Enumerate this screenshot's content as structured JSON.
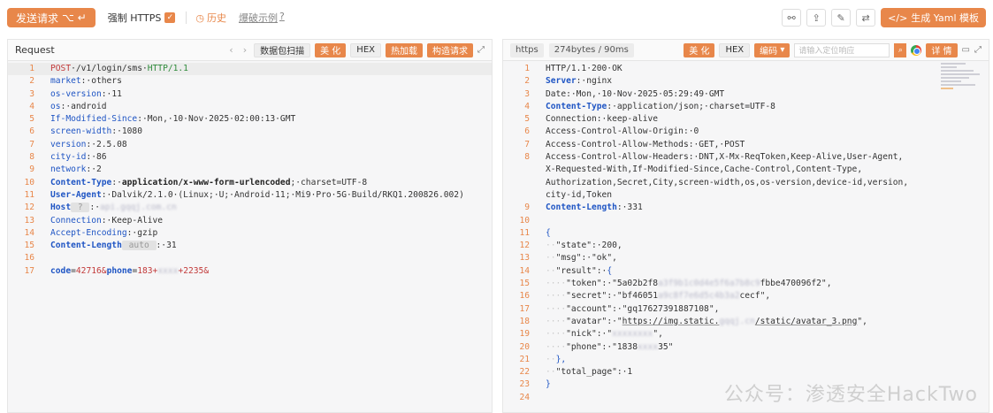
{
  "toolbar": {
    "send_label": "发送请求",
    "send_shortcut": "⌥ ↵",
    "force_https_label": "强制 HTTPS",
    "force_https_checked": true,
    "history_label": "历史",
    "example_label": "爆破示例",
    "yaml_label": "生成 Yaml 模板"
  },
  "request": {
    "title": "Request",
    "buttons": {
      "scan": "数据包扫描",
      "beautify": "美 化",
      "hex": "HEX",
      "hotload": "热加载",
      "build": "构造请求"
    },
    "lines": [
      {
        "n": "1",
        "hl": true,
        "parts": [
          [
            "k-method",
            "POST"
          ],
          [
            "txt",
            "·/v1/login/sms·"
          ],
          [
            "k-proto",
            "HTTP/1.1"
          ]
        ]
      },
      {
        "n": "2",
        "parts": [
          [
            "k-key",
            "market"
          ],
          [
            "txt",
            ":·others"
          ]
        ]
      },
      {
        "n": "3",
        "parts": [
          [
            "k-key",
            "os-version"
          ],
          [
            "txt",
            ":·11"
          ]
        ]
      },
      {
        "n": "4",
        "parts": [
          [
            "k-key",
            "os"
          ],
          [
            "txt",
            ":·android"
          ]
        ]
      },
      {
        "n": "5",
        "parts": [
          [
            "k-key",
            "If-Modified-Since"
          ],
          [
            "txt",
            ":·Mon,·10·Nov·2025·02:00:13·GMT"
          ]
        ]
      },
      {
        "n": "6",
        "parts": [
          [
            "k-key",
            "screen-width"
          ],
          [
            "txt",
            ":·1080"
          ]
        ]
      },
      {
        "n": "7",
        "parts": [
          [
            "k-key",
            "version"
          ],
          [
            "txt",
            ":·2.5.08"
          ]
        ]
      },
      {
        "n": "8",
        "parts": [
          [
            "k-key",
            "city-id"
          ],
          [
            "txt",
            ":·86"
          ]
        ]
      },
      {
        "n": "9",
        "parts": [
          [
            "k-key",
            "network"
          ],
          [
            "txt",
            ":·2"
          ]
        ]
      },
      {
        "n": "10",
        "parts": [
          [
            "k-keyb",
            "Content-Type"
          ],
          [
            "txt",
            ":·"
          ],
          [
            "k-valb",
            "application/x-www-form-urlencoded"
          ],
          [
            "txt",
            ";·charset=UTF-8"
          ]
        ]
      },
      {
        "n": "11",
        "parts": [
          [
            "k-keyb",
            "User-Agent"
          ],
          [
            "txt",
            ":·Dalvik/2.1.0·(Linux;·U;·Android·11;·Mi9·Pro·5G·Build/RKQ1.200826.002)"
          ]
        ]
      },
      {
        "n": "12",
        "parts": [
          [
            "k-keyb",
            "Host"
          ],
          [
            "pill",
            " ? "
          ],
          [
            "txt",
            ":·"
          ],
          [
            "blur",
            "api.gqqj.com.cn"
          ]
        ]
      },
      {
        "n": "13",
        "parts": [
          [
            "k-key",
            "Connection"
          ],
          [
            "txt",
            ":·Keep-Alive"
          ]
        ]
      },
      {
        "n": "14",
        "parts": [
          [
            "k-key",
            "Accept-Encoding"
          ],
          [
            "txt",
            ":·gzip"
          ]
        ]
      },
      {
        "n": "15",
        "parts": [
          [
            "k-keyb",
            "Content-Length"
          ],
          [
            "pill",
            " auto "
          ],
          [
            "txt",
            ":·31"
          ]
        ]
      },
      {
        "n": "16",
        "parts": []
      },
      {
        "n": "17",
        "parts": [
          [
            "k-keyb",
            "code"
          ],
          [
            "txt",
            "="
          ],
          [
            "k-bval",
            "42716"
          ],
          [
            "k-amp",
            "&"
          ],
          [
            "k-keyb",
            "phone"
          ],
          [
            "txt",
            "="
          ],
          [
            "k-bval",
            "183+"
          ],
          [
            "blur",
            "xxxx"
          ],
          [
            "k-bval",
            "+2235"
          ],
          [
            "k-amp",
            "&"
          ]
        ]
      }
    ]
  },
  "response": {
    "tag_https": "https",
    "tag_meta": "274bytes / 90ms",
    "buttons": {
      "beautify": "美 化",
      "hex": "HEX",
      "encode": "编码",
      "detail": "详 情"
    },
    "search_placeholder": "请输入定位响应",
    "lines": [
      {
        "n": "1",
        "parts": [
          [
            "txt",
            "HTTP/1.1·200·OK"
          ]
        ]
      },
      {
        "n": "2",
        "parts": [
          [
            "k-keyb",
            "Server"
          ],
          [
            "txt",
            ":·nginx"
          ]
        ]
      },
      {
        "n": "3",
        "parts": [
          [
            "txt",
            "Date:·Mon,·10·Nov·2025·05:29:49·GMT"
          ]
        ]
      },
      {
        "n": "4",
        "parts": [
          [
            "k-keyb",
            "Content-Type"
          ],
          [
            "txt",
            ":·application/json;·charset=UTF-8"
          ]
        ]
      },
      {
        "n": "5",
        "parts": [
          [
            "txt",
            "Connection:·keep-alive"
          ]
        ]
      },
      {
        "n": "6",
        "parts": [
          [
            "txt",
            "Access-Control-Allow-Origin:·0"
          ]
        ]
      },
      {
        "n": "7",
        "parts": [
          [
            "txt",
            "Access-Control-Allow-Methods:·GET,·POST"
          ]
        ]
      },
      {
        "n": "8",
        "parts": [
          [
            "txt",
            "Access-Control-Allow-Headers:·DNT,X-Mx-ReqToken,Keep-Alive,User-Agent,"
          ]
        ]
      },
      {
        "n": "",
        "parts": [
          [
            "txt",
            "X-Requested-With,If-Modified-Since,Cache-Control,Content-Type,"
          ]
        ]
      },
      {
        "n": "",
        "parts": [
          [
            "txt",
            "Authorization,Secret,City,screen-width,os,os-version,device-id,version,"
          ]
        ]
      },
      {
        "n": "",
        "parts": [
          [
            "txt",
            "city-id,Token"
          ]
        ]
      },
      {
        "n": "9",
        "parts": [
          [
            "k-keyb",
            "Content-Length"
          ],
          [
            "txt",
            ":·331"
          ]
        ]
      },
      {
        "n": "10",
        "parts": []
      },
      {
        "n": "11",
        "parts": [
          [
            "k-key",
            "{"
          ]
        ]
      },
      {
        "n": "12",
        "parts": [
          [
            "guide",
            "··"
          ],
          [
            "txt",
            "\"state\":·200,"
          ]
        ]
      },
      {
        "n": "13",
        "parts": [
          [
            "guide",
            "··"
          ],
          [
            "txt",
            "\"msg\":·\"ok\","
          ]
        ]
      },
      {
        "n": "14",
        "parts": [
          [
            "guide",
            "··"
          ],
          [
            "txt",
            "\"result\":·"
          ],
          [
            "k-key",
            "{"
          ]
        ]
      },
      {
        "n": "15",
        "parts": [
          [
            "guide",
            "····"
          ],
          [
            "txt",
            "\"token\":·\"5a02b2f8"
          ],
          [
            "blur",
            "a3f9b1c0d4e5f6a7b8c9"
          ],
          [
            "txt",
            "fbbe470096f2\","
          ]
        ]
      },
      {
        "n": "16",
        "parts": [
          [
            "guide",
            "····"
          ],
          [
            "txt",
            "\"secret\":·\"bf46051"
          ],
          [
            "blur",
            "a9c8f7e6d5c4b3a2"
          ],
          [
            "txt",
            "cecf\","
          ]
        ]
      },
      {
        "n": "17",
        "parts": [
          [
            "guide",
            "····"
          ],
          [
            "txt",
            "\"account\":·\"gq17627391887108\","
          ]
        ]
      },
      {
        "n": "18",
        "parts": [
          [
            "guide",
            "····"
          ],
          [
            "txt",
            "\"avatar\":·\""
          ],
          [
            "link",
            "https://img.static."
          ],
          [
            "blur",
            "gqqj.cn"
          ],
          [
            "link",
            "/static/avatar_3.png"
          ],
          [
            "txt",
            "\","
          ]
        ]
      },
      {
        "n": "19",
        "parts": [
          [
            "guide",
            "····"
          ],
          [
            "txt",
            "\"nick\":·\""
          ],
          [
            "blur",
            "xxxxxxxx"
          ],
          [
            "txt",
            "\","
          ]
        ]
      },
      {
        "n": "20",
        "parts": [
          [
            "guide",
            "····"
          ],
          [
            "txt",
            "\"phone\":·\"1838"
          ],
          [
            "blur",
            "xxxx"
          ],
          [
            "txt",
            "35\""
          ]
        ]
      },
      {
        "n": "21",
        "parts": [
          [
            "guide",
            "··"
          ],
          [
            "k-key",
            "},"
          ]
        ]
      },
      {
        "n": "22",
        "parts": [
          [
            "guide",
            "··"
          ],
          [
            "txt",
            "\"total_page\":·1"
          ]
        ]
      },
      {
        "n": "23",
        "parts": [
          [
            "k-key",
            "}"
          ]
        ]
      },
      {
        "n": "24",
        "parts": []
      }
    ]
  },
  "watermark": "公众号：渗透安全HackTwo"
}
